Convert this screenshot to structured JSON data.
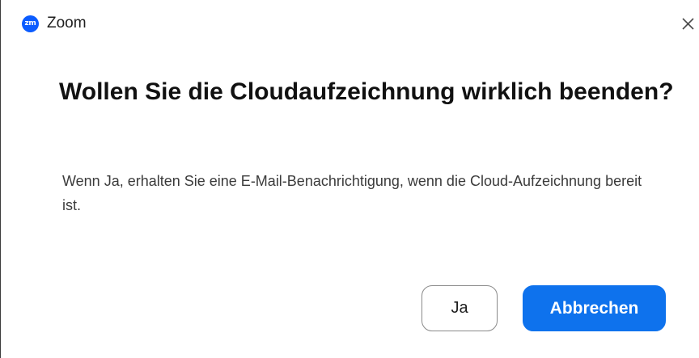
{
  "window": {
    "app_logo_text": "zm",
    "app_title": "Zoom",
    "close_icon": "close-icon"
  },
  "dialog": {
    "heading": "Wollen Sie die Cloudaufzeichnung wirklich beenden?",
    "message": "Wenn Ja, erhalten Sie eine E-Mail-Benachrichtigung, wenn die Cloud-Aufzeichnung bereit ist.",
    "buttons": {
      "confirm_label": "Ja",
      "cancel_label": "Abbrechen"
    }
  },
  "colors": {
    "brand_blue": "#0b5cff",
    "primary_button": "#0e72ed",
    "heading_text": "#111111",
    "body_text": "#3b3b3b"
  }
}
